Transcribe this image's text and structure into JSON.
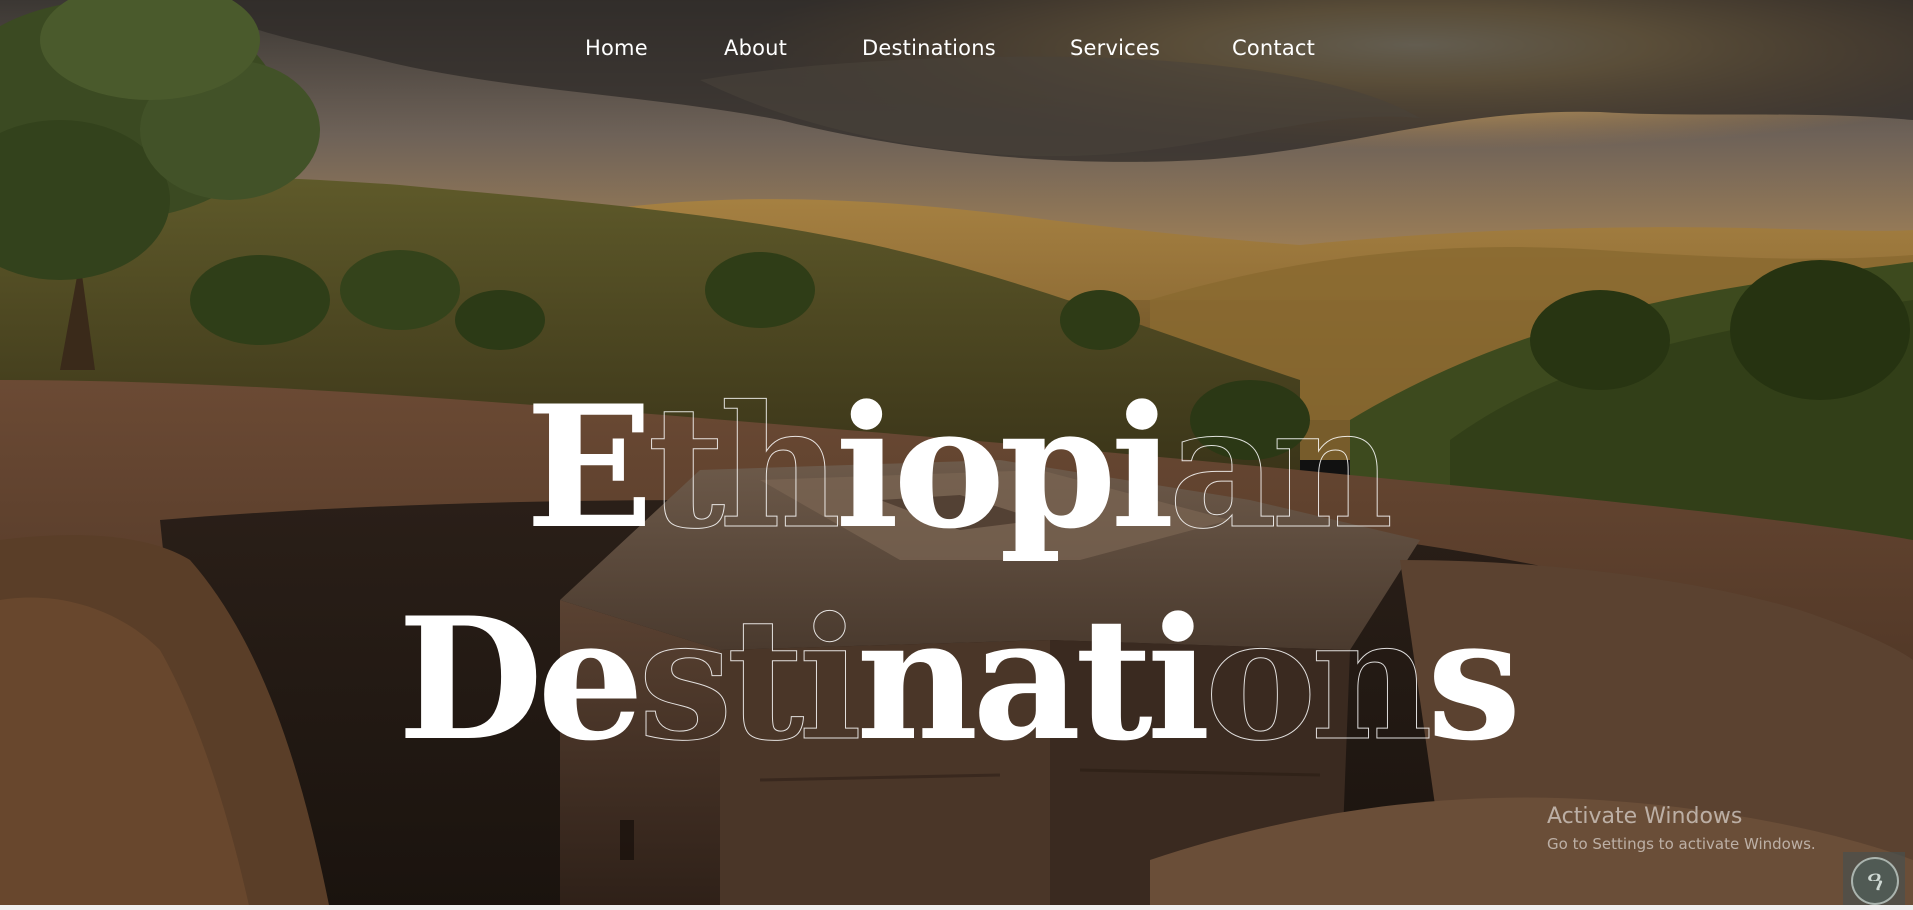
{
  "nav": {
    "items": [
      {
        "label": "Home"
      },
      {
        "label": "About"
      },
      {
        "label": "Destinations"
      },
      {
        "label": "Services"
      },
      {
        "label": "Contact"
      }
    ]
  },
  "hero": {
    "title_line_1": "Ethiopian",
    "title_line_2": "Destinations",
    "outlined_letters_line_1": [
      false,
      true,
      true,
      false,
      false,
      false,
      false,
      true,
      true
    ],
    "outlined_letters_line_2": [
      false,
      false,
      true,
      true,
      true,
      false,
      false,
      false,
      false,
      true,
      true,
      false
    ]
  },
  "watermark": {
    "title": "Activate Windows",
    "subtitle": "Go to Settings to activate Windows."
  },
  "corner_widget": {
    "glyph": "ዓ"
  },
  "colors": {
    "text": "#ffffff",
    "sky_top": "#3a3632",
    "sun_glow": "#fbe6a8",
    "rock": "#4a3526"
  }
}
